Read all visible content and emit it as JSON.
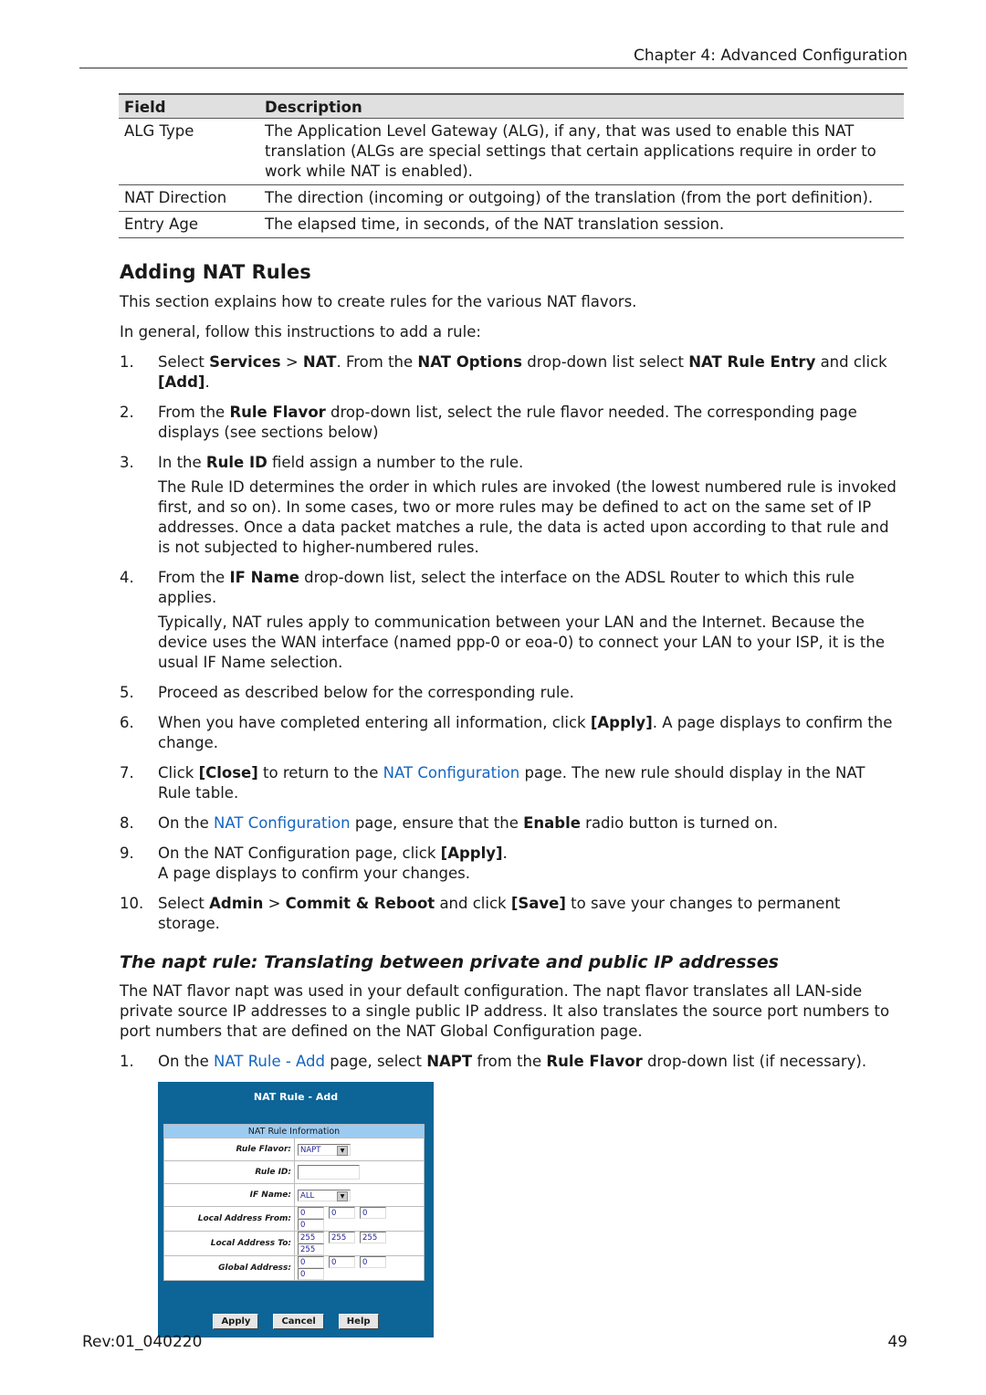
{
  "header": {
    "chapter": "Chapter 4: Advanced Configuration"
  },
  "table": {
    "headers": [
      "Field",
      "Description"
    ],
    "rows": [
      [
        "ALG Type",
        "The Application Level Gateway (ALG), if any, that was used to enable this NAT translation (ALGs are special settings that certain applications require in order to work while NAT is enabled)."
      ],
      [
        "NAT Direction",
        "The direction (incoming or outgoing) of the translation (from the port definition)."
      ],
      [
        "Entry Age",
        "The elapsed time, in seconds, of the NAT translation session."
      ]
    ]
  },
  "section": {
    "title": "Adding NAT Rules",
    "intro1": "This section explains how to create rules for the various NAT flavors.",
    "intro2": "In general, follow this instructions to add a rule:",
    "steps": [
      {
        "n": "1.",
        "runs": [
          [
            "Select ",
            ""
          ],
          [
            "Services",
            "b"
          ],
          [
            " > ",
            ""
          ],
          [
            "NAT",
            "b"
          ],
          [
            ". From the ",
            ""
          ],
          [
            "NAT Options",
            "b"
          ],
          [
            " drop-down list select ",
            ""
          ],
          [
            "NAT Rule Entry",
            "b"
          ],
          [
            " and click ",
            ""
          ],
          [
            "[Add]",
            "b"
          ],
          [
            ".",
            ""
          ]
        ]
      },
      {
        "n": "2.",
        "runs": [
          [
            "From the ",
            ""
          ],
          [
            "Rule Flavor",
            "b"
          ],
          [
            " drop-down list, select the rule flavor needed. The corresponding page displays (see sections below)",
            ""
          ]
        ]
      },
      {
        "n": "3.",
        "runs": [
          [
            "In the ",
            ""
          ],
          [
            "Rule ID",
            "b"
          ],
          [
            " field assign a number to the rule.",
            ""
          ]
        ],
        "sub": "The Rule ID determines the order in which rules are invoked (the lowest numbered rule is invoked first, and so on). In some cases, two or more rules may be defined to act on the same set of IP addresses. Once a data packet matches a rule, the data is acted upon according to that rule and is not subjected to higher-numbered rules."
      },
      {
        "n": "4.",
        "runs": [
          [
            "From the ",
            ""
          ],
          [
            "IF Name",
            "b"
          ],
          [
            " drop-down list, select the interface on the ADSL Router to which this rule applies.",
            ""
          ]
        ],
        "sub": "Typically, NAT rules apply to communication between your LAN and the Internet. Because the device uses the WAN interface (named ppp-0 or eoa-0) to connect your LAN to your ISP, it is the usual IF Name selection."
      },
      {
        "n": "5.",
        "runs": [
          [
            "Proceed as described below for the corresponding rule.",
            ""
          ]
        ]
      },
      {
        "n": "6.",
        "runs": [
          [
            "When you have completed entering all information, click ",
            ""
          ],
          [
            "[Apply]",
            "b"
          ],
          [
            ". A page displays to confirm the change.",
            ""
          ]
        ]
      },
      {
        "n": "7.",
        "runs": [
          [
            "Click ",
            ""
          ],
          [
            "[Close]",
            "b"
          ],
          [
            " to return to the ",
            ""
          ],
          [
            "NAT Configuration",
            "lk"
          ],
          [
            " page. The new rule should display in the NAT Rule table.",
            ""
          ]
        ]
      },
      {
        "n": "8.",
        "runs": [
          [
            "On the ",
            ""
          ],
          [
            "NAT Configuration",
            "lk"
          ],
          [
            " page, ensure that the ",
            ""
          ],
          [
            "Enable",
            "b"
          ],
          [
            " radio button is turned on.",
            ""
          ]
        ]
      },
      {
        "n": "9.",
        "runs": [
          [
            "On the NAT Configuration page, click ",
            ""
          ],
          [
            "[Apply]",
            "b"
          ],
          [
            ".",
            ""
          ]
        ],
        "line2": "A page displays to confirm your changes."
      },
      {
        "n": "10.",
        "runs": [
          [
            "Select ",
            ""
          ],
          [
            "Admin",
            "b"
          ],
          [
            " > ",
            ""
          ],
          [
            "Commit & Reboot",
            "b"
          ],
          [
            " and click ",
            ""
          ],
          [
            "[Save]",
            "b"
          ],
          [
            " to save your changes to permanent storage.",
            ""
          ]
        ]
      }
    ]
  },
  "napt": {
    "title": "The napt rule: Translating between private and public IP addresses",
    "para": "The NAT flavor napt was used in your default configuration. The napt flavor translates all LAN-side private source IP addresses to a single public IP address. It also translates the source port numbers to port numbers that are defined on the NAT Global Configuration page.",
    "step": {
      "n": "1.",
      "runs": [
        [
          "On the ",
          ""
        ],
        [
          "NAT Rule - Add",
          "lk"
        ],
        [
          " page, select ",
          ""
        ],
        [
          "NAPT",
          "b"
        ],
        [
          " from the ",
          ""
        ],
        [
          "Rule Flavor",
          "b"
        ],
        [
          " drop-down list (if necessary).",
          ""
        ]
      ]
    }
  },
  "screenshot": {
    "title": "NAT Rule - Add",
    "section": "NAT Rule Information",
    "rule_flavor_label": "Rule Flavor:",
    "rule_flavor": "NAPT",
    "rule_id_label": "Rule ID:",
    "rule_id": "",
    "if_name_label": "IF Name:",
    "if_name": "ALL",
    "local_from_label": "Local Address From:",
    "local_from": [
      "0",
      "0",
      "0",
      "0"
    ],
    "local_to_label": "Local Address To:",
    "local_to": [
      "255",
      "255",
      "255",
      "255"
    ],
    "global_label": "Global Address:",
    "global": [
      "0",
      "0",
      "0",
      "0"
    ],
    "apply": "Apply",
    "cancel": "Cancel",
    "help": "Help",
    "bg_color": "#0c6497"
  },
  "footer": {
    "rev": "Rev:01_040220",
    "page": "49"
  },
  "colors": {
    "link": "#1565c0"
  }
}
